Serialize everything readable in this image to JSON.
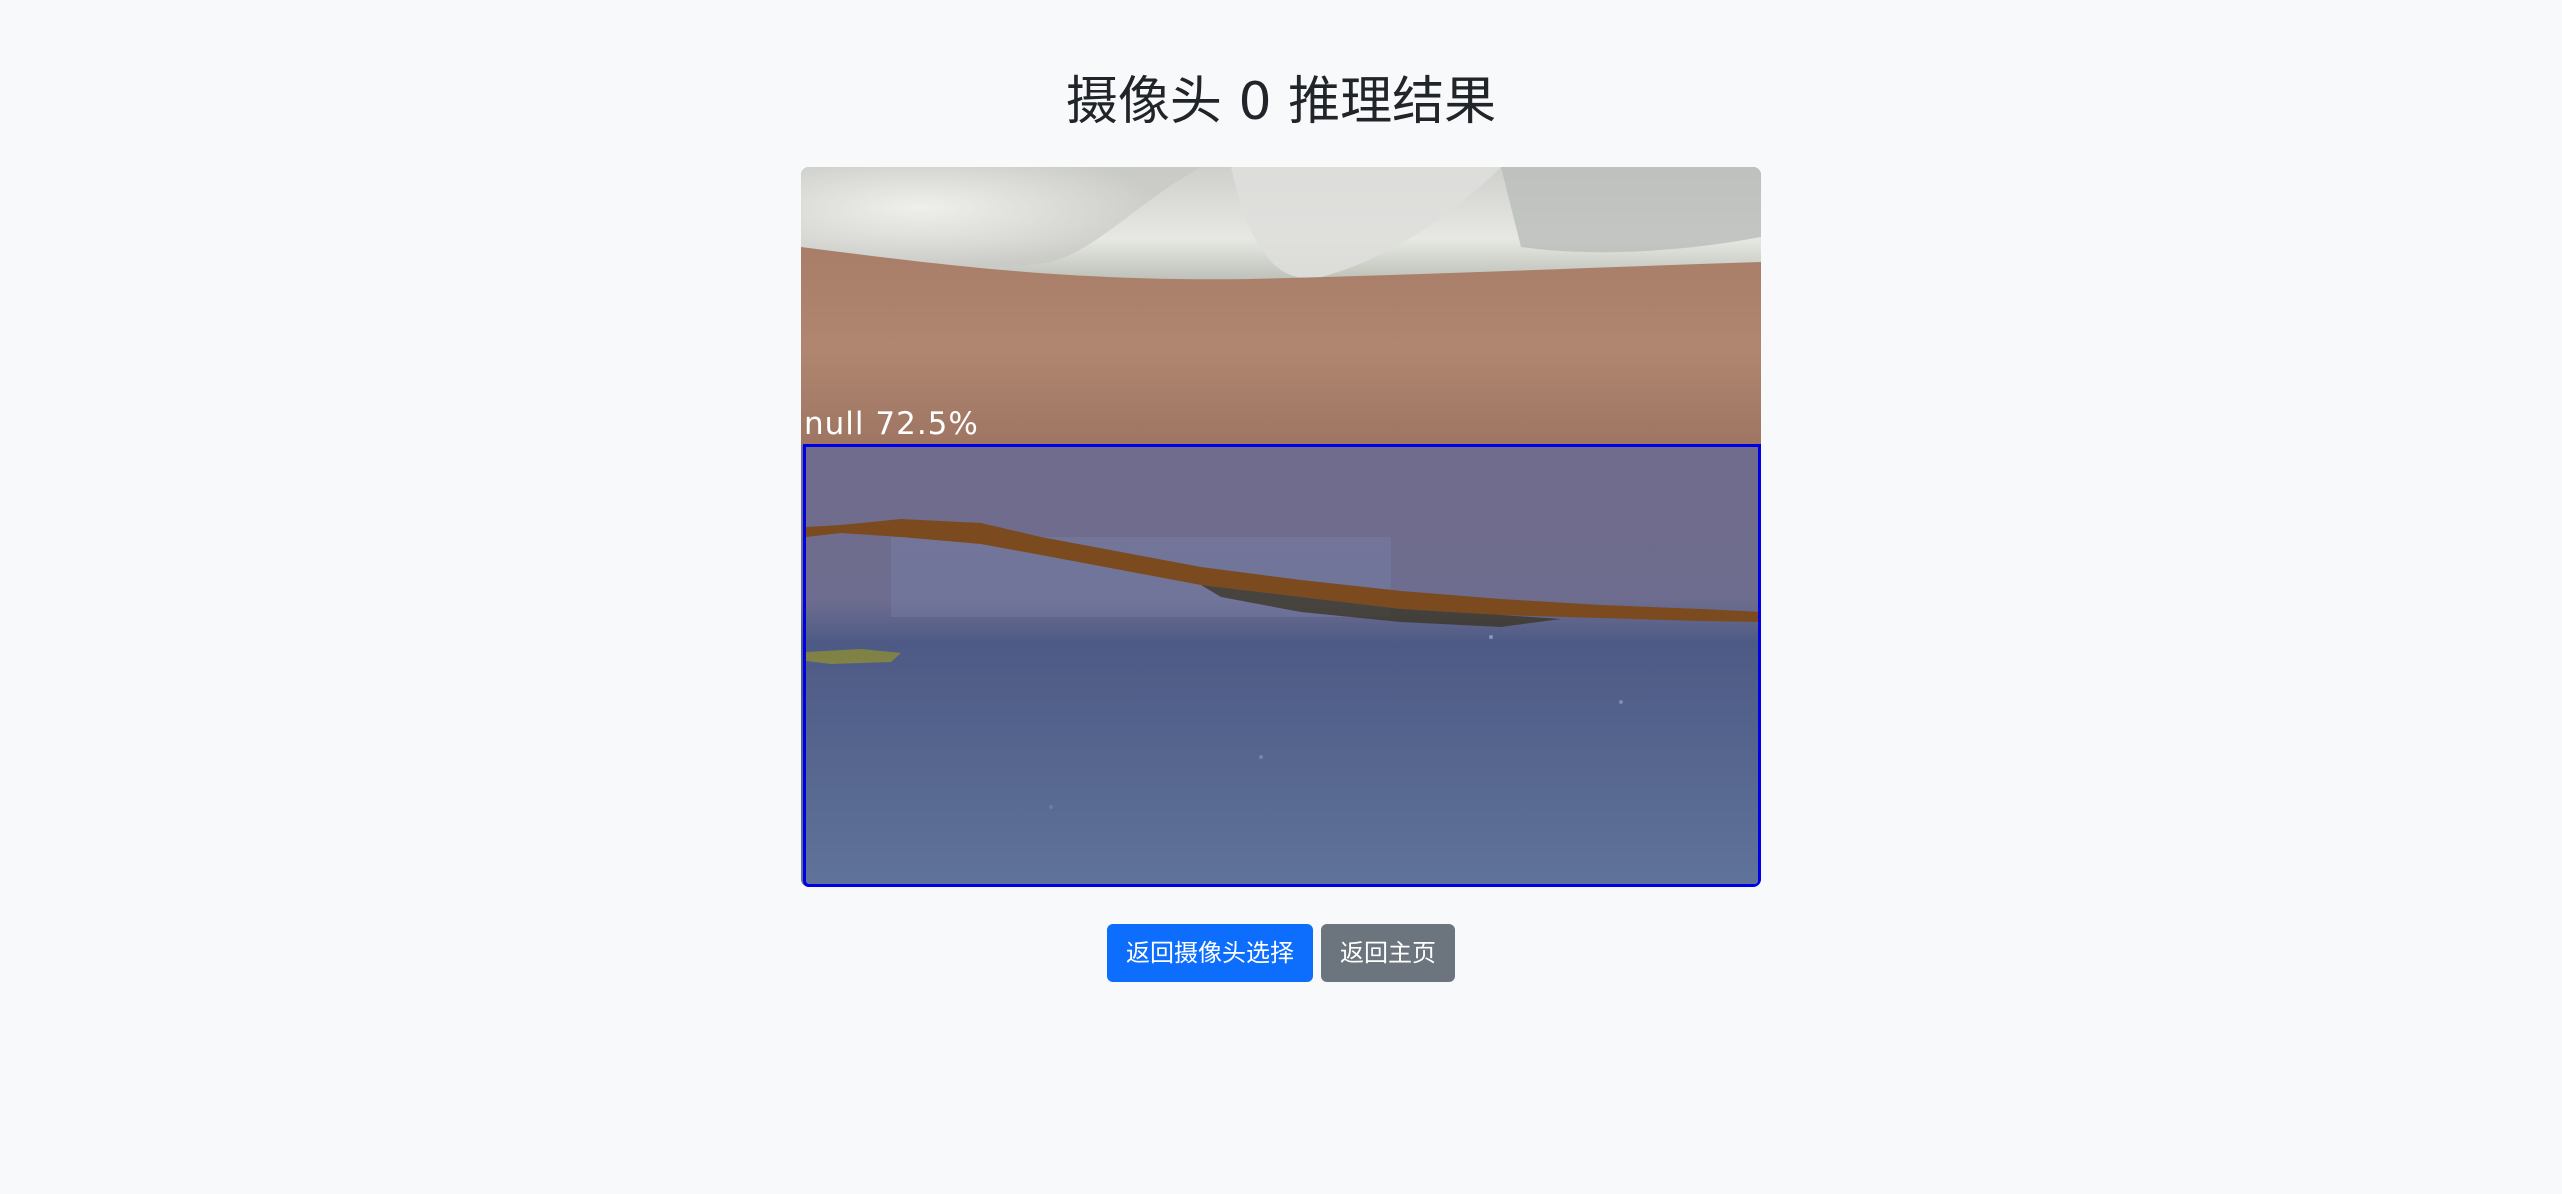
{
  "page": {
    "title": "摄像头 0 推理结果"
  },
  "result": {
    "detection_label": "null 72.5%",
    "box_color": "#0000e6"
  },
  "actions": {
    "back_to_camera_label": "返回摄像头选择",
    "back_to_home_label": "返回主页"
  },
  "colors": {
    "primary": "#0d6efd",
    "secondary": "#6c757d",
    "background": "#f8f9fa"
  }
}
